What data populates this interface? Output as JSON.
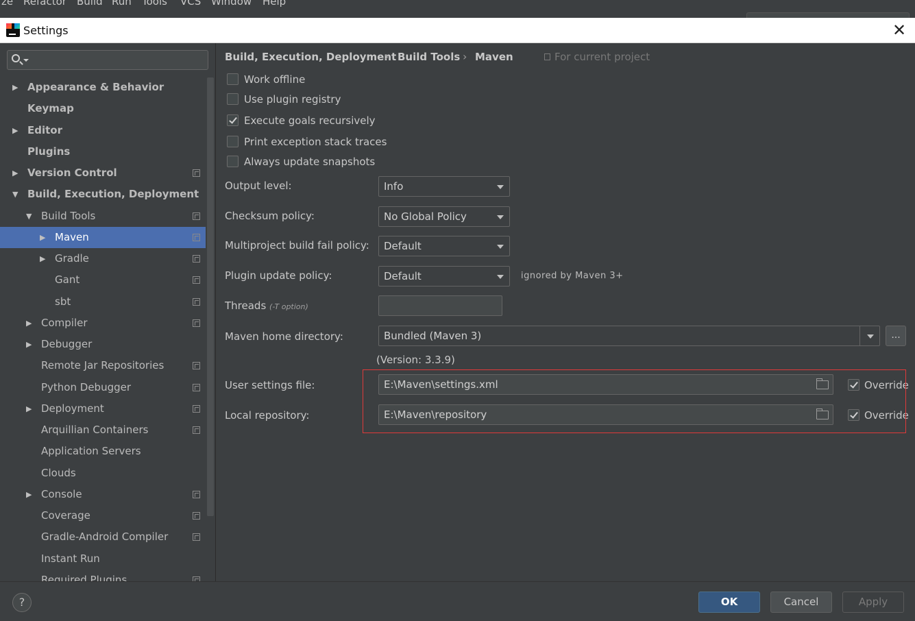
{
  "menubar": {
    "items": [
      "ze",
      "Refactor",
      "Build",
      "Run",
      "Tools",
      "VCS",
      "Window",
      "Help"
    ]
  },
  "window": {
    "title": "Settings",
    "close": "✕"
  },
  "sidebar": {
    "items": [
      {
        "label": "Appearance & Behavior",
        "bold": true,
        "expandable": true,
        "expanded": false,
        "level": 0,
        "project": false
      },
      {
        "label": "Keymap",
        "bold": true,
        "expandable": false,
        "level": 0,
        "project": false
      },
      {
        "label": "Editor",
        "bold": true,
        "expandable": true,
        "expanded": false,
        "level": 0,
        "project": false
      },
      {
        "label": "Plugins",
        "bold": true,
        "expandable": false,
        "level": 0,
        "project": false
      },
      {
        "label": "Version Control",
        "bold": true,
        "expandable": true,
        "expanded": false,
        "level": 0,
        "project": true
      },
      {
        "label": "Build, Execution, Deployment",
        "bold": true,
        "expandable": true,
        "expanded": true,
        "level": 0,
        "project": false
      },
      {
        "label": "Build Tools",
        "bold": false,
        "expandable": true,
        "expanded": true,
        "level": 1,
        "project": true
      },
      {
        "label": "Maven",
        "bold": false,
        "expandable": true,
        "expanded": false,
        "level": 2,
        "project": true,
        "selected": true
      },
      {
        "label": "Gradle",
        "bold": false,
        "expandable": true,
        "expanded": false,
        "level": 2,
        "project": true
      },
      {
        "label": "Gant",
        "bold": false,
        "expandable": false,
        "level": 2,
        "project": true
      },
      {
        "label": "sbt",
        "bold": false,
        "expandable": false,
        "level": 2,
        "project": true
      },
      {
        "label": "Compiler",
        "bold": false,
        "expandable": true,
        "expanded": false,
        "level": 1,
        "project": true
      },
      {
        "label": "Debugger",
        "bold": false,
        "expandable": true,
        "expanded": false,
        "level": 1,
        "project": false
      },
      {
        "label": "Remote Jar Repositories",
        "bold": false,
        "expandable": false,
        "level": 1,
        "project": true
      },
      {
        "label": "Python Debugger",
        "bold": false,
        "expandable": false,
        "level": 1,
        "project": true
      },
      {
        "label": "Deployment",
        "bold": false,
        "expandable": true,
        "expanded": false,
        "level": 1,
        "project": true
      },
      {
        "label": "Arquillian Containers",
        "bold": false,
        "expandable": false,
        "level": 1,
        "project": true
      },
      {
        "label": "Application Servers",
        "bold": false,
        "expandable": false,
        "level": 1,
        "project": false
      },
      {
        "label": "Clouds",
        "bold": false,
        "expandable": false,
        "level": 1,
        "project": false
      },
      {
        "label": "Console",
        "bold": false,
        "expandable": true,
        "expanded": false,
        "level": 1,
        "project": true
      },
      {
        "label": "Coverage",
        "bold": false,
        "expandable": false,
        "level": 1,
        "project": true
      },
      {
        "label": "Gradle-Android Compiler",
        "bold": false,
        "expandable": false,
        "level": 1,
        "project": true
      },
      {
        "label": "Instant Run",
        "bold": false,
        "expandable": false,
        "level": 1,
        "project": false
      },
      {
        "label": "Required Plugins",
        "bold": false,
        "expandable": false,
        "level": 1,
        "project": true
      }
    ]
  },
  "breadcrumb": {
    "parts": [
      "Build, Execution, Deployment",
      "Build Tools",
      "Maven"
    ],
    "separator": "›",
    "scope": "For current project"
  },
  "checkboxes": [
    {
      "label": "Work offline",
      "checked": false
    },
    {
      "label": "Use plugin registry",
      "checked": false
    },
    {
      "label": "Execute goals recursively",
      "checked": true
    },
    {
      "label": "Print exception stack traces",
      "checked": false
    },
    {
      "label": "Always update snapshots",
      "checked": false
    }
  ],
  "form": {
    "output_level": {
      "label": "Output level:",
      "value": "Info"
    },
    "checksum_policy": {
      "label": "Checksum policy:",
      "value": "No Global Policy"
    },
    "multiproject_fail": {
      "label": "Multiproject build fail policy:",
      "value": "Default"
    },
    "plugin_update": {
      "label": "Plugin update policy:",
      "value": "Default",
      "hint": "ignored by Maven 3+"
    },
    "threads": {
      "label": "Threads",
      "note": "(-T option)",
      "value": ""
    },
    "maven_home": {
      "label": "Maven home directory:",
      "value": "Bundled (Maven 3)",
      "browse": "...",
      "version": "(Version: 3.3.9)"
    },
    "user_settings": {
      "label": "User settings file:",
      "value": "E:\\Maven\\settings.xml",
      "override_label": "Override",
      "override": true
    },
    "local_repo": {
      "label": "Local repository:",
      "value": "E:\\Maven\\repository",
      "override_label": "Override",
      "override": true
    }
  },
  "footer": {
    "help": "?",
    "ok": "OK",
    "cancel": "Cancel",
    "apply": "Apply"
  },
  "colors": {
    "selection": "#4b6eaf",
    "primary_button": "#365880",
    "highlight_frame": "#e03a3a",
    "background": "#3c3f41"
  }
}
